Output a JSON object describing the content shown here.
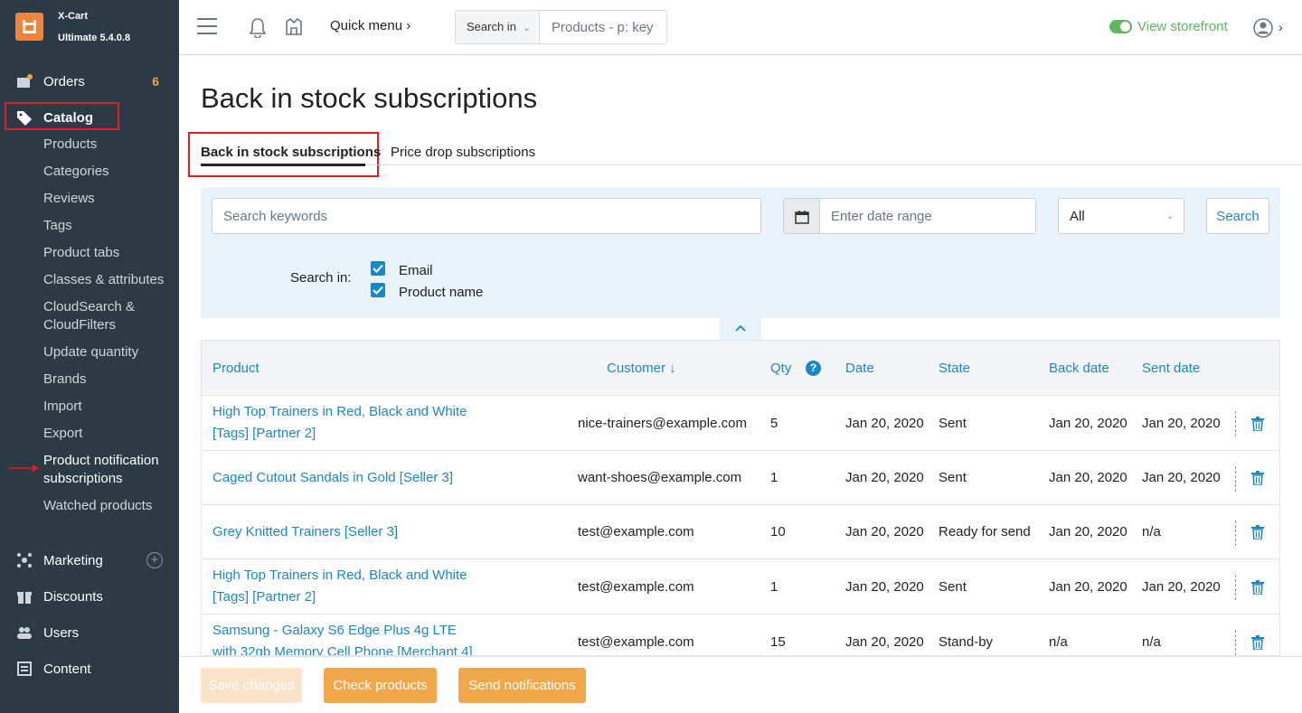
{
  "brand": {
    "name": "X-Cart",
    "version": "Ultimate 5.4.0.8"
  },
  "sidebar": {
    "orders": {
      "label": "Orders",
      "badge": "6"
    },
    "catalog": {
      "label": "Catalog"
    },
    "catalog_items": [
      "Products",
      "Categories",
      "Reviews",
      "Tags",
      "Product tabs",
      "Classes & attributes",
      "CloudSearch & CloudFilters",
      "Update quantity",
      "Brands",
      "Import",
      "Export",
      "Product notification subscriptions",
      "Watched products"
    ],
    "marketing": {
      "label": "Marketing"
    },
    "discounts": {
      "label": "Discounts"
    },
    "users": {
      "label": "Users"
    },
    "content": {
      "label": "Content"
    }
  },
  "header": {
    "quick_menu": "Quick menu",
    "search_in": "Search in",
    "search_placeholder": "Products - p: key",
    "view_storefront": "View storefront"
  },
  "page": {
    "title": "Back in stock subscriptions",
    "tabs": [
      "Back in stock subscriptions",
      "Price drop subscriptions"
    ]
  },
  "filter": {
    "keywords_placeholder": "Search keywords",
    "date_placeholder": "Enter date range",
    "status_value": "All",
    "search_button": "Search",
    "search_in_label": "Search in:",
    "options": [
      "Email",
      "Product name"
    ]
  },
  "table": {
    "headers": {
      "product": "Product",
      "customer": "Customer ↓",
      "qty": "Qty",
      "date": "Date",
      "state": "State",
      "back_date": "Back date",
      "sent_date": "Sent date"
    },
    "rows": [
      {
        "product": "High Top Trainers in Red, Black and White [Tags] [Partner 2]",
        "customer": "nice-trainers@example.com",
        "qty": "5",
        "date": "Jan 20, 2020",
        "state": "Sent",
        "back_date": "Jan 20, 2020",
        "sent_date": "Jan 20, 2020"
      },
      {
        "product": "Caged Cutout Sandals in Gold [Seller 3]",
        "customer": "want-shoes@example.com",
        "qty": "1",
        "date": "Jan 20, 2020",
        "state": "Sent",
        "back_date": "Jan 20, 2020",
        "sent_date": "Jan 20, 2020"
      },
      {
        "product": "Grey Knitted Trainers [Seller 3]",
        "customer": "test@example.com",
        "qty": "10",
        "date": "Jan 20, 2020",
        "state": "Ready for send",
        "back_date": "Jan 20, 2020",
        "sent_date": "n/a"
      },
      {
        "product": "High Top Trainers in Red, Black and White [Tags] [Partner 2]",
        "customer": "test@example.com",
        "qty": "1",
        "date": "Jan 20, 2020",
        "state": "Sent",
        "back_date": "Jan 20, 2020",
        "sent_date": "Jan 20, 2020"
      },
      {
        "product": "Samsung - Galaxy S6 Edge Plus 4g LTE with 32gb Memory Cell Phone [Merchant 4]",
        "customer": "test@example.com",
        "qty": "15",
        "date": "Jan 20, 2020",
        "state": "Stand-by",
        "back_date": "n/a",
        "sent_date": "n/a"
      }
    ]
  },
  "footer": {
    "save": "Save changes",
    "check": "Check products",
    "send": "Send notifications"
  }
}
